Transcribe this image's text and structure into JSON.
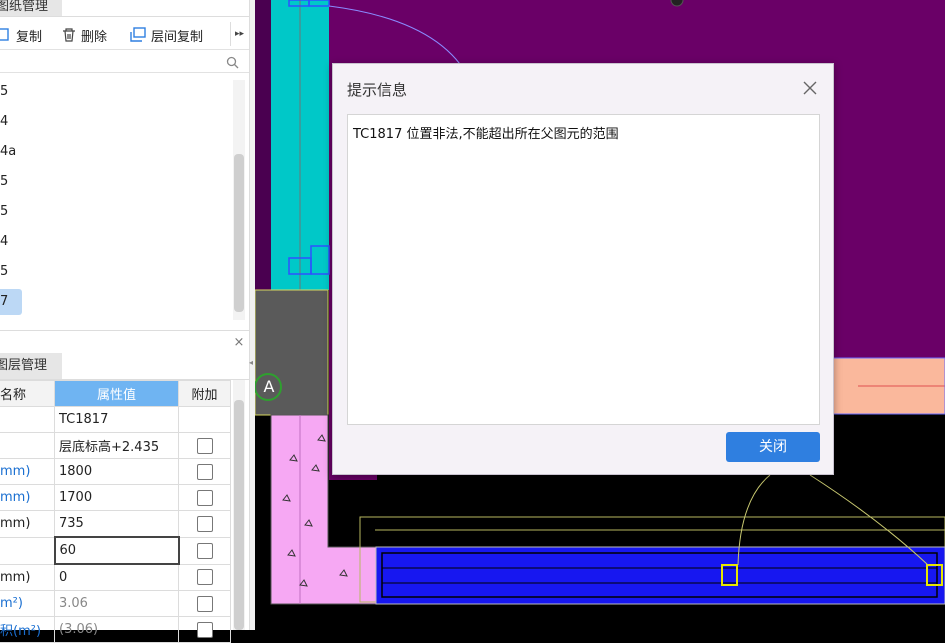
{
  "drawing_panel": {
    "tab_label": "图纸管理",
    "toolbar": {
      "copy_label": "复制",
      "delete_label": "删除",
      "floor_copy_label": "层间复制"
    },
    "items": [
      "5",
      "4",
      "4a",
      "5",
      "5",
      "4",
      "5",
      "7"
    ]
  },
  "layer_panel": {
    "tab_label": "图层管理",
    "columns": [
      "名称",
      "属性值",
      "附加"
    ],
    "rows": [
      {
        "name": "",
        "value": "TC1817"
      },
      {
        "name": "",
        "value": "层底标高+2.435"
      },
      {
        "name": "mm)",
        "value": "1800"
      },
      {
        "name": "mm)",
        "value": "1700"
      },
      {
        "name": "mm)",
        "value": "735"
      },
      {
        "name": "",
        "value": "60"
      },
      {
        "name": "mm)",
        "value": "0"
      },
      {
        "name": "m²)",
        "value": "3.06"
      },
      {
        "name": "积(m²)",
        "value": "(3.06)"
      }
    ]
  },
  "canvas": {
    "axis_label": "A"
  },
  "dialog": {
    "title": "提示信息",
    "message": "TC1817 位置非法,不能超出所在父图元的范围",
    "close_button": "关闭"
  },
  "colors": {
    "accent": "#2f7fe0",
    "purple_fill": "#6a0067",
    "cyan_fill": "#00c8c8",
    "blue_beam": "#1717f0",
    "pink_wall": "#f6a8f3",
    "salmon": "#fab89c",
    "header_blue": "#6fb4f2"
  }
}
